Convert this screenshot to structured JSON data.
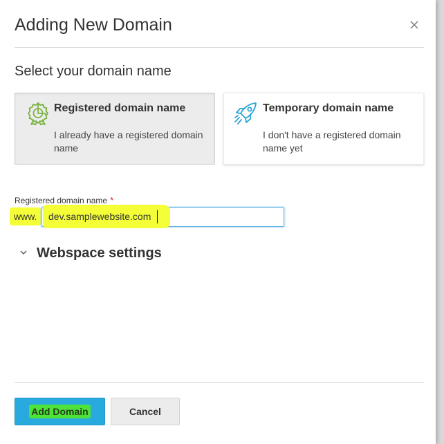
{
  "dialog": {
    "title": "Adding New Domain",
    "close_icon": "close-icon"
  },
  "section": {
    "title": "Select your domain name"
  },
  "options": [
    {
      "title": "Registered domain name",
      "description": "I already have a registered domain name",
      "icon": "award-badge-icon",
      "selected": true
    },
    {
      "title": "Temporary domain name",
      "description": "I don't have a registered domain name yet",
      "icon": "rocket-icon",
      "selected": false
    }
  ],
  "domain_field": {
    "label": "Registered domain name",
    "required_mark": "*",
    "prefix": "www.",
    "value": "dev.samplewebsite.com"
  },
  "webspace": {
    "label": "Webspace settings"
  },
  "footer": {
    "add_label": "Add Domain",
    "cancel_label": "Cancel"
  },
  "colors": {
    "accent": "#28aade",
    "highlight": "#f4ff38",
    "required": "#d02a2a",
    "icon_green": "#7cb342",
    "icon_blue": "#29a3d6"
  }
}
